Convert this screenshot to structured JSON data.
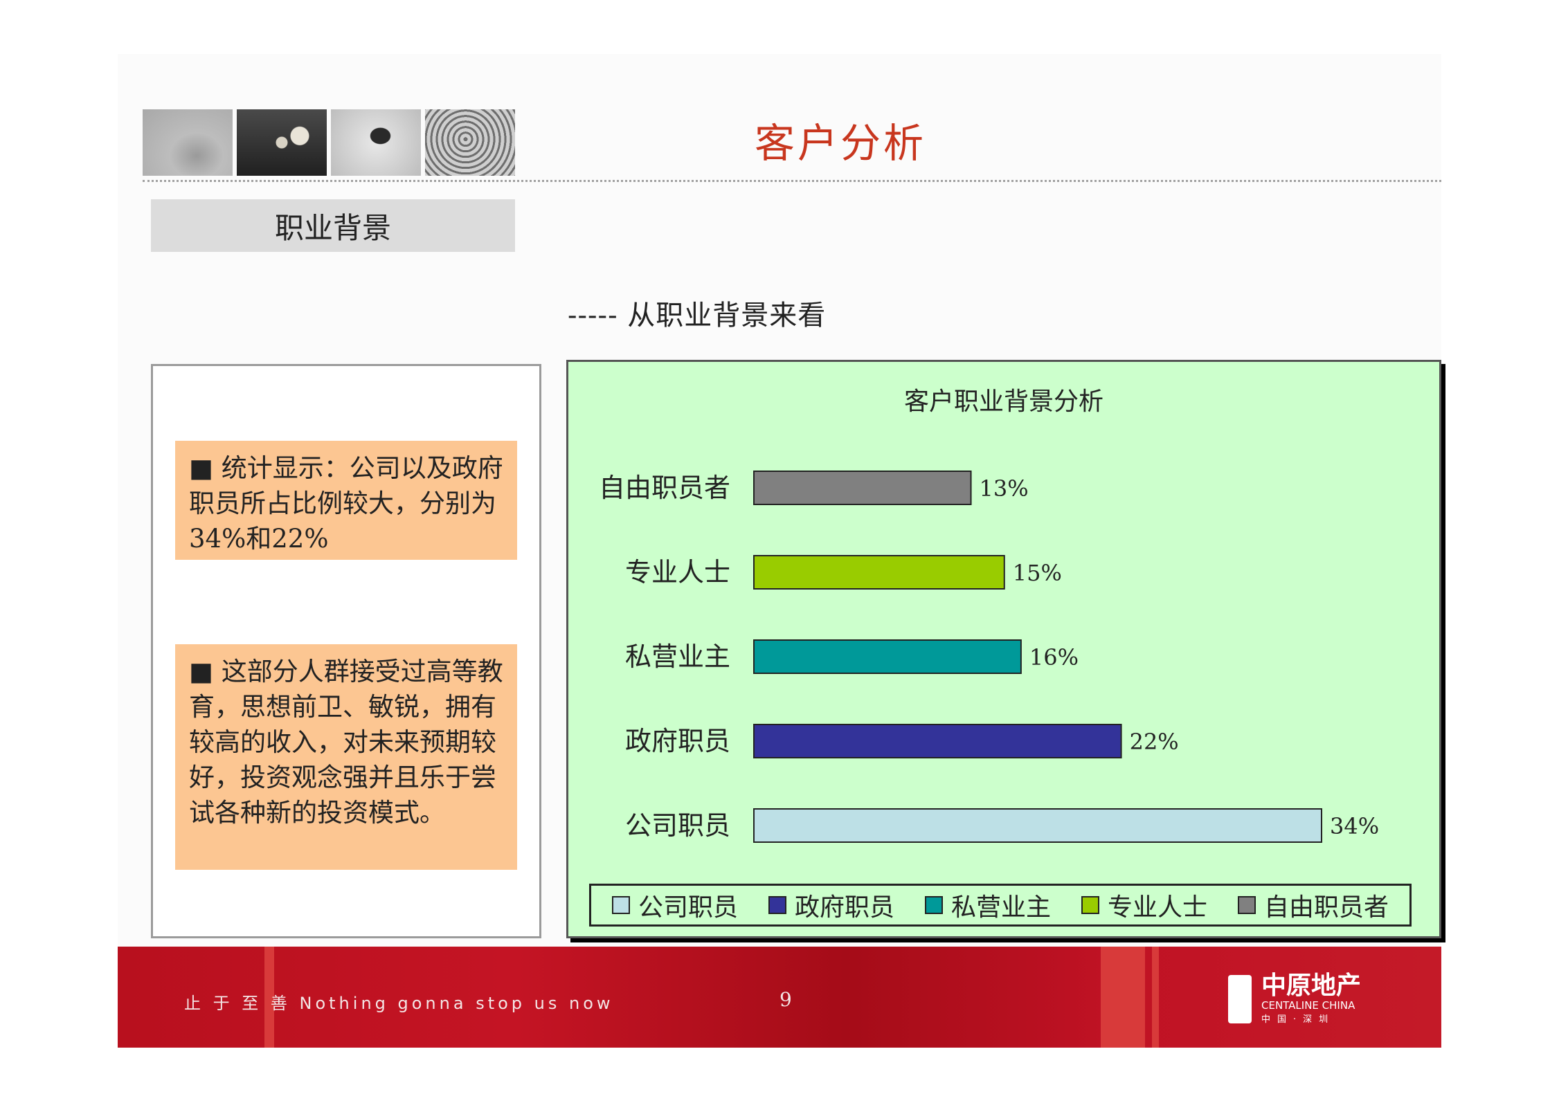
{
  "header": {
    "title": "客户分析",
    "section": "职业背景",
    "subtitle": "----- 从职业背景来看"
  },
  "notes": [
    "■  统计显示：公司以及政府职员所占比例较大，分别为34%和22%",
    "■   这部分人群接受过高等教育，思想前卫、敏锐，拥有较高的收入，对未来预期较好，投资观念强并且乐于尝试各种新的投资模式。"
  ],
  "chart_data": {
    "type": "bar",
    "orientation": "horizontal",
    "title": "客户职业背景分析",
    "categories": [
      "自由职员者",
      "专业人士",
      "私营业主",
      "政府职员",
      "公司职员"
    ],
    "values": [
      13,
      15,
      16,
      22,
      34
    ],
    "value_labels": [
      "13%",
      "15%",
      "16%",
      "22%",
      "34%"
    ],
    "unit": "%",
    "colors": [
      "#808080",
      "#99cc00",
      "#009999",
      "#333399",
      "#bde0e6"
    ],
    "legend": {
      "position": "bottom",
      "items": [
        {
          "label": "公司职员",
          "color": "#bde0e6"
        },
        {
          "label": "政府职员",
          "color": "#333399"
        },
        {
          "label": "私营业主",
          "color": "#009999"
        },
        {
          "label": "专业人士",
          "color": "#99cc00"
        },
        {
          "label": "自由职员者",
          "color": "#808080"
        }
      ]
    },
    "xlim": [
      0,
      34
    ],
    "grid": false
  },
  "footer": {
    "motto": "止 于 至 善   Nothing gonna stop us now",
    "page_number": "9",
    "logo_cn": "中原地产",
    "logo_en": "CENTALINE CHINA",
    "logo_sub": "中国·深圳"
  }
}
